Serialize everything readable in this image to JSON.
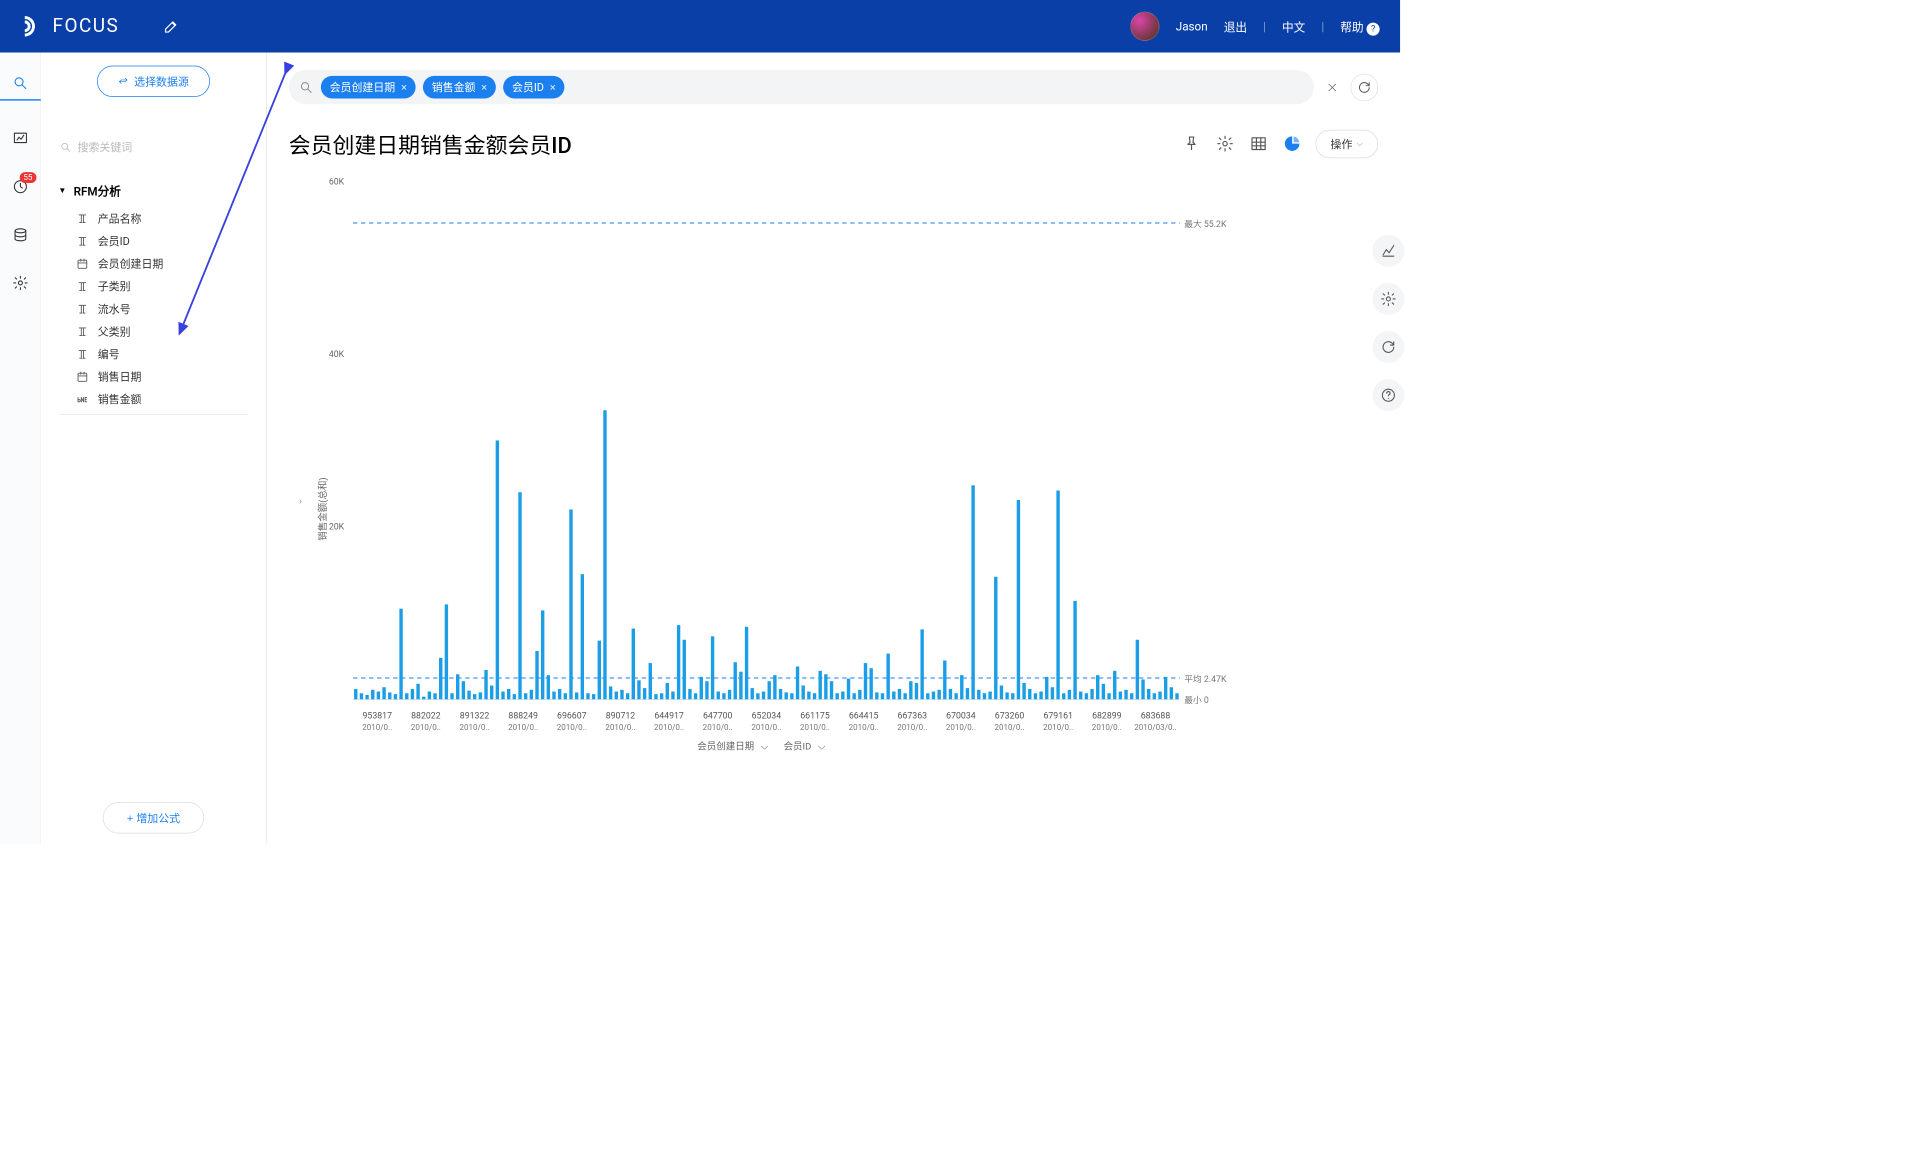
{
  "header": {
    "brand": "FOCUS",
    "user": "Jason",
    "logout": "退出",
    "lang": "中文",
    "help": "帮助"
  },
  "rail": {
    "badge": "55"
  },
  "sidebar": {
    "select_ds": "选择数据源",
    "search_placeholder": "搜索关键词",
    "tree_title": "RFM分析",
    "items": [
      {
        "icon": "text",
        "label": "产品名称"
      },
      {
        "icon": "text",
        "label": "会员ID"
      },
      {
        "icon": "date",
        "label": "会员创建日期"
      },
      {
        "icon": "text",
        "label": "子类别"
      },
      {
        "icon": "text",
        "label": "流水号"
      },
      {
        "icon": "text",
        "label": "父类别"
      },
      {
        "icon": "text",
        "label": "编号"
      },
      {
        "icon": "date",
        "label": "销售日期"
      },
      {
        "icon": "num",
        "label": "销售金额"
      }
    ],
    "add_formula": "+  增加公式"
  },
  "query": {
    "chips": [
      "会员创建日期",
      "销售金额",
      "会员ID"
    ]
  },
  "page": {
    "title": "会员创建日期销售金额会员ID",
    "op_btn": "操作"
  },
  "chart_data": {
    "type": "bar",
    "ylabel": "销售金额(总和)",
    "yticks": [
      0,
      20000,
      40000,
      60000
    ],
    "ytick_labels": [
      "",
      "20K",
      "40K",
      "60K"
    ],
    "ylim": [
      0,
      60000
    ],
    "max_line": {
      "value": 55200,
      "label": "最大 55.2K"
    },
    "avg_line": {
      "value": 2470,
      "label": "平均 2.47K"
    },
    "min_line": {
      "value": 0,
      "label": "最小 0"
    },
    "x_axis_legend": [
      "会员创建日期",
      "会员ID"
    ],
    "x_major": [
      {
        "id": "953817",
        "date": "2010/0.."
      },
      {
        "id": "882022",
        "date": "2010/0.."
      },
      {
        "id": "891322",
        "date": "2010/0.."
      },
      {
        "id": "888249",
        "date": "2010/0.."
      },
      {
        "id": "696607",
        "date": "2010/0.."
      },
      {
        "id": "890712",
        "date": "2010/0.."
      },
      {
        "id": "644917",
        "date": "2010/0.."
      },
      {
        "id": "647700",
        "date": "2010/0.."
      },
      {
        "id": "652034",
        "date": "2010/0.."
      },
      {
        "id": "661175",
        "date": "2010/0.."
      },
      {
        "id": "664415",
        "date": "2010/0.."
      },
      {
        "id": "667363",
        "date": "2010/0.."
      },
      {
        "id": "670034",
        "date": "2010/0.."
      },
      {
        "id": "673260",
        "date": "2010/0.."
      },
      {
        "id": "679161",
        "date": "2010/0.."
      },
      {
        "id": "682899",
        "date": "2010/0.."
      },
      {
        "id": "683688",
        "date": "2010/03/0.."
      }
    ],
    "values": [
      1200,
      700,
      500,
      1100,
      900,
      1400,
      800,
      600,
      10500,
      700,
      1200,
      1800,
      300,
      900,
      700,
      4800,
      11000,
      700,
      2900,
      2100,
      1000,
      600,
      800,
      3400,
      1600,
      30000,
      900,
      1200,
      600,
      24000,
      700,
      1100,
      5600,
      10300,
      2800,
      900,
      1200,
      700,
      22000,
      800,
      14500,
      700,
      600,
      6800,
      33500,
      1500,
      900,
      1100,
      700,
      8200,
      2200,
      1300,
      4200,
      600,
      700,
      1900,
      900,
      8600,
      6900,
      1200,
      700,
      2600,
      2100,
      7300,
      900,
      700,
      1100,
      4300,
      3200,
      8400,
      1300,
      700,
      900,
      2100,
      2800,
      1200,
      800,
      700,
      3800,
      1600,
      900,
      700,
      3300,
      2900,
      2100,
      700,
      900,
      2400,
      700,
      1100,
      4200,
      3600,
      800,
      700,
      5300,
      900,
      1200,
      700,
      2100,
      1900,
      8100,
      700,
      900,
      1100,
      4500,
      1200,
      700,
      2800,
      1300,
      24800,
      1100,
      700,
      900,
      14200,
      1600,
      800,
      700,
      23100,
      1900,
      1200,
      700,
      900,
      2600,
      1400,
      24200,
      700,
      1100,
      11400,
      900,
      700,
      1200,
      2800,
      1800,
      700,
      3300,
      900,
      1100,
      700,
      6900,
      2300,
      1200,
      700,
      900,
      2600,
      1400,
      700
    ]
  }
}
